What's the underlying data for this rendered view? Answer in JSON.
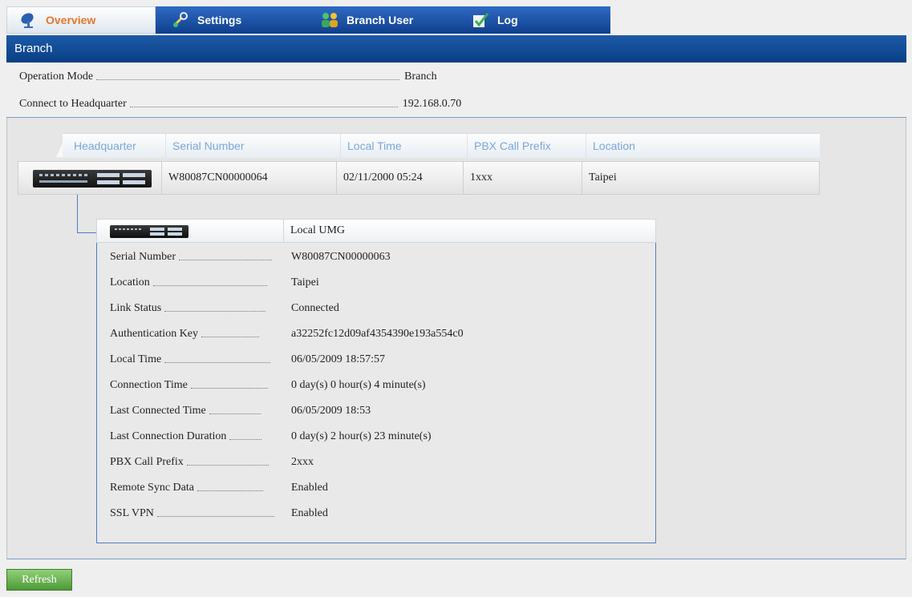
{
  "tabs": {
    "overview": "Overview",
    "settings": "Settings",
    "branch_user": "Branch User",
    "log": "Log"
  },
  "header": {
    "title": "Branch"
  },
  "info": {
    "operation_mode_label": "Operation Mode",
    "operation_mode_value": "Branch",
    "connect_hq_label": "Connect to Headquarter",
    "connect_hq_value": "192.168.0.70"
  },
  "hq_table": {
    "columns": [
      "Headquarter",
      "Serial Number",
      "Local Time",
      "PBX Call Prefix",
      "Location"
    ],
    "row": {
      "serial": "W80087CN00000064",
      "local_time": "02/11/2000 05:24",
      "prefix": "1xxx",
      "location": "Taipei"
    }
  },
  "local_umg": {
    "title": "Local UMG",
    "rows": [
      {
        "label": "Serial Number",
        "value": "W80087CN00000063"
      },
      {
        "label": "Location",
        "value": "Taipei"
      },
      {
        "label": "Link Status",
        "value": "Connected"
      },
      {
        "label": "Authentication Key",
        "value": "a32252fc12d09af4354390e193a554c0"
      },
      {
        "label": "Local Time",
        "value": "06/05/2009 18:57:57"
      },
      {
        "label": "Connection Time",
        "value": "0 day(s) 0 hour(s) 4 minute(s)"
      },
      {
        "label": "Last Connected Time",
        "value": "06/05/2009 18:53"
      },
      {
        "label": "Last Connection Duration",
        "value": "0 day(s) 2 hour(s) 23 minute(s)"
      },
      {
        "label": "PBX Call Prefix",
        "value": "2xxx"
      },
      {
        "label": "Remote Sync Data",
        "value": "Enabled"
      },
      {
        "label": "SSL VPN",
        "value": "Enabled"
      }
    ]
  },
  "buttons": {
    "refresh": "Refresh"
  },
  "colors": {
    "tab_blue": "#0f3f8c",
    "active_tab_text": "#e8752b",
    "header_blue": "#0a3f86",
    "refresh_green": "#4c9a36"
  }
}
